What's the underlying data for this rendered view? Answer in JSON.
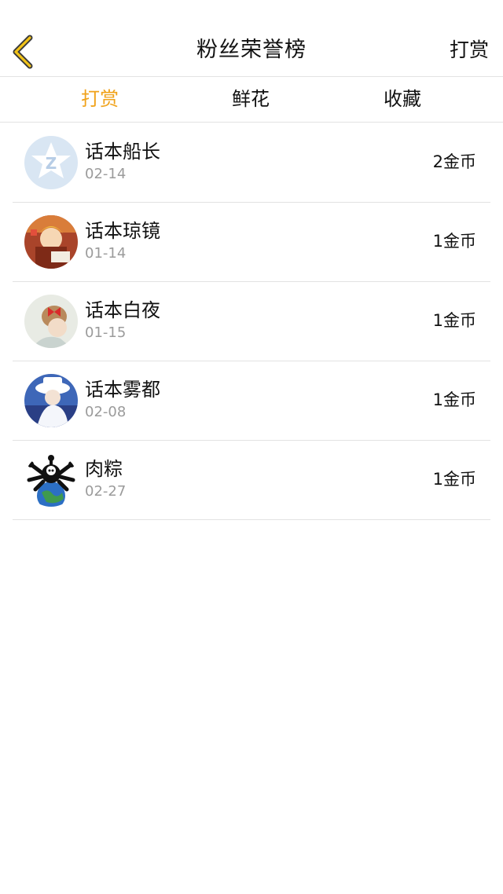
{
  "header": {
    "title": "粉丝荣誉榜",
    "action_label": "打赏",
    "back_icon": "chevron-left-icon",
    "accent_color": "#f0a21a"
  },
  "tabs": [
    {
      "label": "打赏",
      "active": true
    },
    {
      "label": "鲜花",
      "active": false
    },
    {
      "label": "收藏",
      "active": false
    }
  ],
  "fans": [
    {
      "name": "话本船长",
      "date": "02-14",
      "amount": "2金币",
      "avatar": "default-qq-avatar"
    },
    {
      "name": "话本琼镜",
      "date": "01-14",
      "amount": "1金币",
      "avatar": "anime-avatar"
    },
    {
      "name": "话本白夜",
      "date": "01-15",
      "amount": "1金币",
      "avatar": "girl-red-bow-avatar"
    },
    {
      "name": "话本雾都",
      "date": "02-08",
      "amount": "1金币",
      "avatar": "anime-white-hat-avatar"
    },
    {
      "name": "肉粽",
      "date": "02-27",
      "amount": "1金币",
      "avatar": "skull-earth-avatar"
    }
  ]
}
